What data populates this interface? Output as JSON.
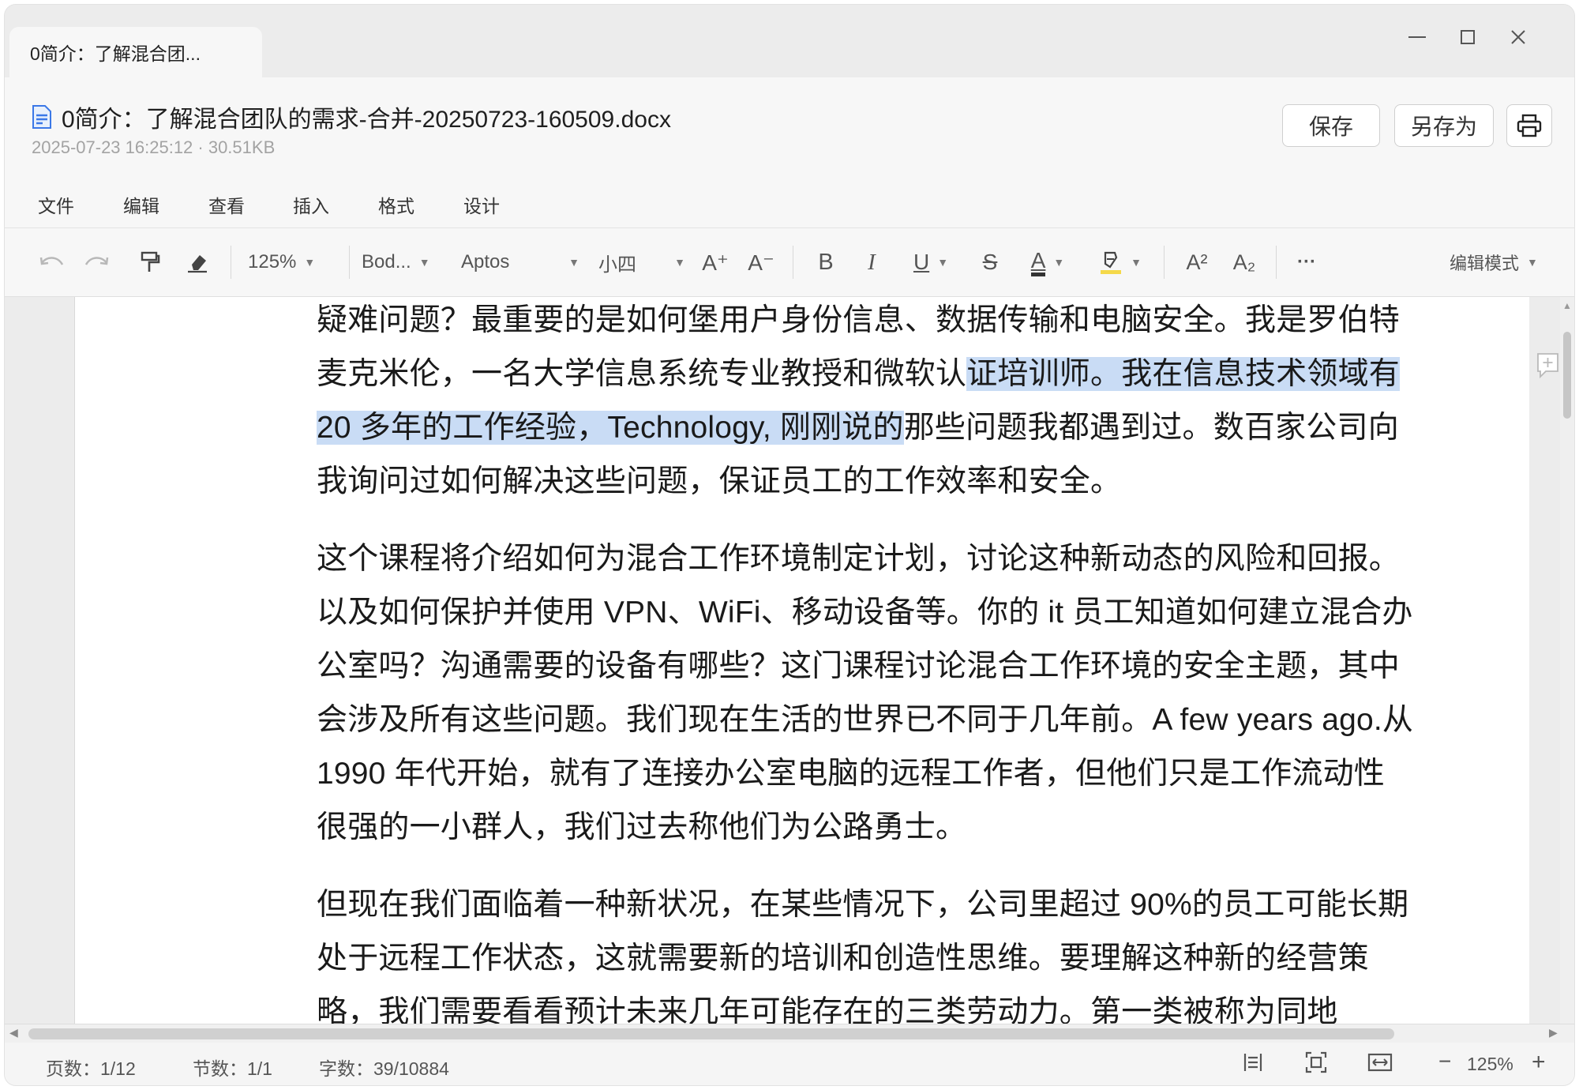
{
  "tab": {
    "title": "0简介：了解混合团..."
  },
  "window_controls": {
    "minimize": "—",
    "maximize": "☐",
    "close": "✕"
  },
  "header": {
    "file_name": "0简介：了解混合团队的需求-合并-20250723-160509.docx",
    "meta": "2025-07-23 16:25:12 · 30.51KB",
    "save_label": "保存",
    "save_as_label": "另存为"
  },
  "menu": [
    "文件",
    "编辑",
    "查看",
    "插入",
    "格式",
    "设计"
  ],
  "toolbar": {
    "zoom": "125%",
    "style": "Bod...",
    "font": "Aptos",
    "size": "小四",
    "grow_font": "A⁺",
    "shrink_font": "A⁻",
    "bold": "B",
    "italic": "I",
    "underline": "U",
    "strike": "S",
    "font_color_glyph": "A",
    "superscript": "A²",
    "subscript": "A₂",
    "more": "···",
    "mode": "编辑模式"
  },
  "document": {
    "p1_before": "疑难问题？最重要的是如何堡用户身份信息、数据传输和电脑安全。我是罗伯特麦克米伦，一名大学信息系统专业教授和微软认",
    "p1_highlight": "证培训师。我在信息技术领域有 20 多年的工作经验，Technology, 刚刚说的",
    "p1_after": "那些问题我都遇到过。数百家公司向我询问过如何解决这些问题，保证员工的工作效率和安全。",
    "p2": "这个课程将介绍如何为混合工作环境制定计划，讨论这种新动态的风险和回报。以及如何保护并使用 VPN、WiFi、移动设备等。你的 it 员工知道如何建立混合办公室吗？沟通需要的设备有哪些？这门课程讨论混合工作环境的安全主题，其中会涉及所有这些问题。我们现在生活的世界已不同于几年前。A few years ago.从 1990 年代开始，就有了连接办公室电脑的远程工作者，但他们只是工作流动性很强的一小群人，我们过去称他们为公路勇士。",
    "p3": "但现在我们面临着一种新状况，在某些情况下，公司里超过 90%的员工可能长期处于远程工作状态，这就需要新的培训和创造性思维。要理解这种新的经营策略，我们需要看看预计未来几年可能存在的三类劳动力。第一类被称为同地"
  },
  "status": {
    "pages": "页数：1/12",
    "sections": "节数：1/1",
    "words": "字数：39/10884",
    "zoom": "125%",
    "zoom_out": "−",
    "zoom_in": "+"
  },
  "colors": {
    "selection": "#c9dcf5",
    "highlight_bar": "#f5d94a",
    "font_color_bar": "#333333"
  }
}
